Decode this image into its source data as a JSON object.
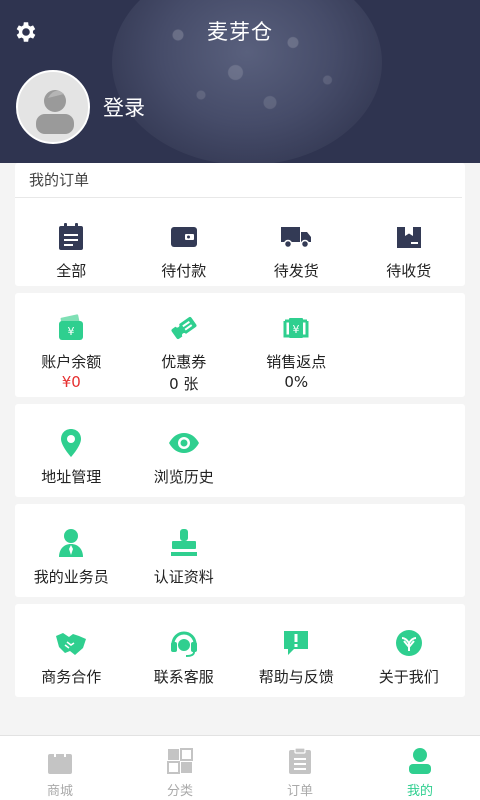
{
  "header": {
    "title": "麦芽仓",
    "login_label": "登录"
  },
  "orders": {
    "heading": "我的订单",
    "items": [
      {
        "label": "全部",
        "icon": "clipboard-icon"
      },
      {
        "label": "待付款",
        "icon": "wallet-icon"
      },
      {
        "label": "待发货",
        "icon": "truck-icon"
      },
      {
        "label": "待收货",
        "icon": "package-icon"
      }
    ]
  },
  "assets": {
    "items": [
      {
        "label": "账户余额",
        "value": "¥0",
        "icon": "yen-wallet-icon"
      },
      {
        "label": "优惠券",
        "value": "0 张",
        "icon": "ticket-icon"
      },
      {
        "label": "销售返点",
        "value": "0%",
        "icon": "rebate-icon"
      }
    ]
  },
  "services": {
    "items": [
      {
        "label": "地址管理",
        "icon": "location-pin-icon"
      },
      {
        "label": "浏览历史",
        "icon": "eye-icon"
      }
    ]
  },
  "profile": {
    "items": [
      {
        "label": "我的业务员",
        "icon": "salesperson-icon"
      },
      {
        "label": "认证资料",
        "icon": "stamp-icon"
      }
    ]
  },
  "support": {
    "items": [
      {
        "label": "商务合作",
        "icon": "handshake-icon"
      },
      {
        "label": "联系客服",
        "icon": "headset-icon"
      },
      {
        "label": "帮助与反馈",
        "icon": "feedback-icon"
      },
      {
        "label": "关于我们",
        "icon": "about-logo-icon"
      }
    ]
  },
  "tabbar": {
    "items": [
      {
        "label": "商城",
        "icon": "shopping-bag-icon",
        "active": false
      },
      {
        "label": "分类",
        "icon": "category-grid-icon",
        "active": false
      },
      {
        "label": "订单",
        "icon": "order-list-icon",
        "active": false
      },
      {
        "label": "我的",
        "icon": "user-icon",
        "active": true
      }
    ]
  },
  "colors": {
    "header_bg": "#2f3450",
    "accent_green": "#2fcf8f",
    "icon_dark": "#333a55",
    "price_red": "#e62e2e"
  }
}
